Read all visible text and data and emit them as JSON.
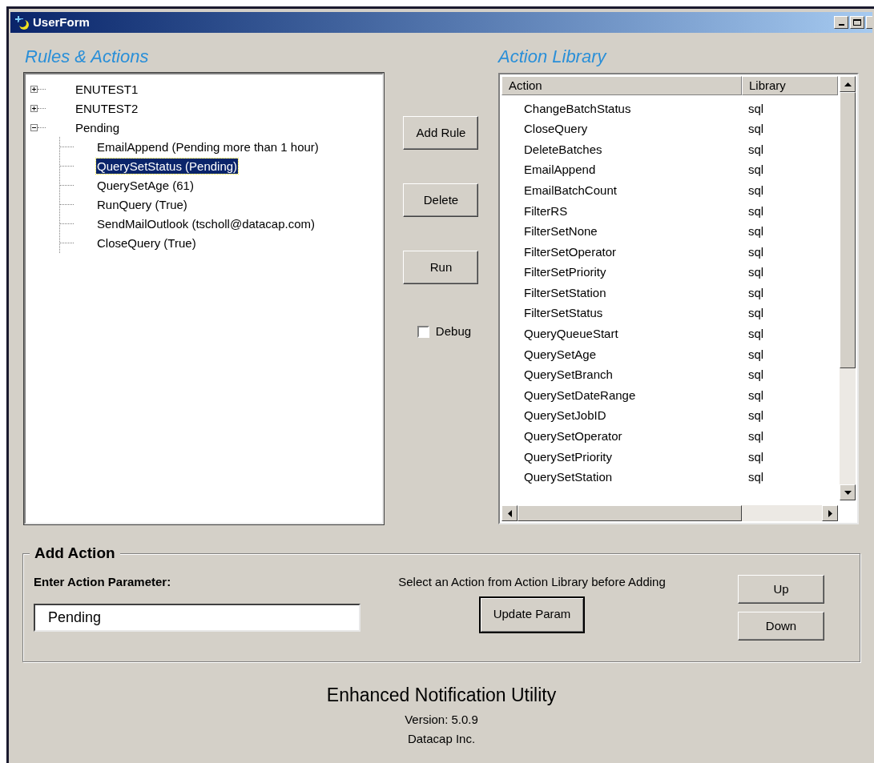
{
  "window": {
    "title": "UserForm"
  },
  "rules_panel": {
    "heading": "Rules & Actions",
    "tree": [
      {
        "label": "ENUTEST1",
        "expanded": false,
        "selected": false
      },
      {
        "label": "ENUTEST2",
        "expanded": false,
        "selected": false
      },
      {
        "label": "Pending",
        "expanded": true,
        "selected": false,
        "children": [
          {
            "label": "EmailAppend (Pending more than 1 hour)",
            "selected": false
          },
          {
            "label": "QuerySetStatus (Pending)",
            "selected": true
          },
          {
            "label": "QuerySetAge (61)",
            "selected": false
          },
          {
            "label": "RunQuery (True)",
            "selected": false
          },
          {
            "label": "SendMailOutlook (tscholl@datacap.com)",
            "selected": false
          },
          {
            "label": "CloseQuery (True)",
            "selected": false
          }
        ]
      }
    ]
  },
  "buttons": [
    "Add Rule",
    "Delete",
    "Run"
  ],
  "debug": {
    "label": "Debug",
    "checked": false
  },
  "library_panel": {
    "heading": "Action Library",
    "columns": [
      "Action",
      "Library"
    ],
    "rows": [
      {
        "action": "ChangeBatchStatus",
        "library": "sql"
      },
      {
        "action": "CloseQuery",
        "library": "sql"
      },
      {
        "action": "DeleteBatches",
        "library": "sql"
      },
      {
        "action": "EmailAppend",
        "library": "sql"
      },
      {
        "action": "EmailBatchCount",
        "library": "sql"
      },
      {
        "action": "FilterRS",
        "library": "sql"
      },
      {
        "action": "FilterSetNone",
        "library": "sql"
      },
      {
        "action": "FilterSetOperator",
        "library": "sql"
      },
      {
        "action": "FilterSetPriority",
        "library": "sql"
      },
      {
        "action": "FilterSetStation",
        "library": "sql"
      },
      {
        "action": "FilterSetStatus",
        "library": "sql"
      },
      {
        "action": "QueryQueueStart",
        "library": "sql"
      },
      {
        "action": "QuerySetAge",
        "library": "sql"
      },
      {
        "action": "QuerySetBranch",
        "library": "sql"
      },
      {
        "action": "QuerySetDateRange",
        "library": "sql"
      },
      {
        "action": "QuerySetJobID",
        "library": "sql"
      },
      {
        "action": "QuerySetOperator",
        "library": "sql"
      },
      {
        "action": "QuerySetPriority",
        "library": "sql"
      },
      {
        "action": "QuerySetStation",
        "library": "sql"
      }
    ]
  },
  "add_action": {
    "title": "Add Action",
    "parameter_label": "Enter Action Parameter:",
    "parameter_value": "Pending",
    "hint": "Select an Action from Action Library before Adding",
    "update_button": "Update Param",
    "move_buttons": [
      "Up",
      "Down"
    ]
  },
  "footer": {
    "title": "Enhanced Notification Utility",
    "version": "Version: 5.0.9",
    "company": "Datacap Inc."
  }
}
